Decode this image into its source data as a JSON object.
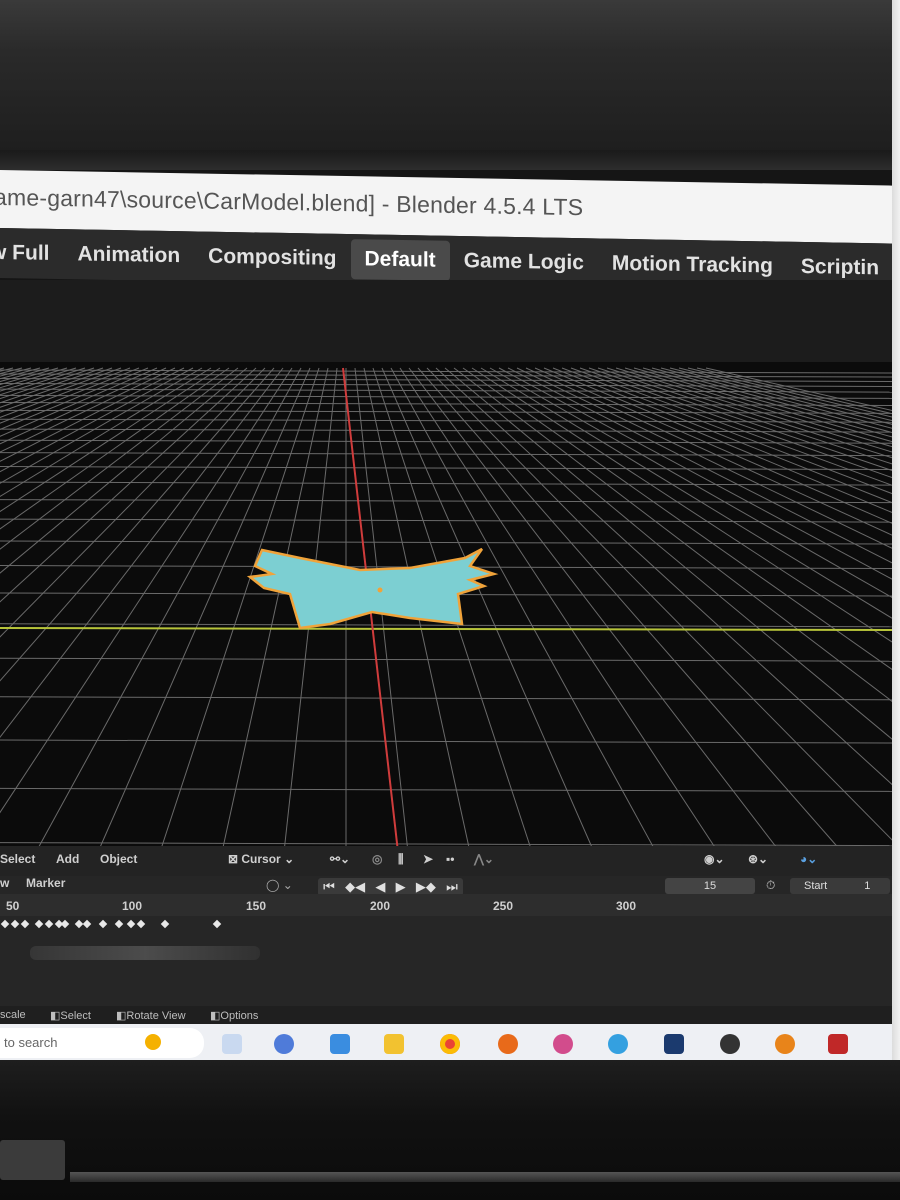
{
  "window": {
    "title": "ame-garn47\\source\\CarModel.blend] - Blender 4.5.4 LTS"
  },
  "workspaces": [
    {
      "label": "w Full",
      "active": false
    },
    {
      "label": "Animation",
      "active": false
    },
    {
      "label": "Compositing",
      "active": false
    },
    {
      "label": "Default",
      "active": true
    },
    {
      "label": "Game Logic",
      "active": false
    },
    {
      "label": "Motion Tracking",
      "active": false
    },
    {
      "label": "Scriptin",
      "active": false
    }
  ],
  "viewport_header": {
    "select": "Select",
    "add": "Add",
    "object": "Object",
    "snap_target": "Cursor"
  },
  "timeline": {
    "view_label": "w",
    "marker_label": "Marker",
    "current_frame": "15",
    "start_label": "Start",
    "start_value": "1",
    "ruler_ticks": [
      "50",
      "100",
      "150",
      "200",
      "250",
      "300"
    ]
  },
  "statusbar": {
    "scale": "scale",
    "select": "Select",
    "rotate_view": "Rotate View",
    "options": "Options"
  },
  "taskbar": {
    "search_placeholder": "to search"
  },
  "colors": {
    "selected_object_fill": "#7ccfd2",
    "selected_outline": "#f0a33a",
    "x_axis": "#d03c3c",
    "y_axis": "#b7c43a",
    "grid": "#8a8a8a"
  },
  "icons": {
    "snap": "cursor-icon",
    "playback": "playback-controls",
    "keyframes": "keyframe-diamond-icon"
  }
}
